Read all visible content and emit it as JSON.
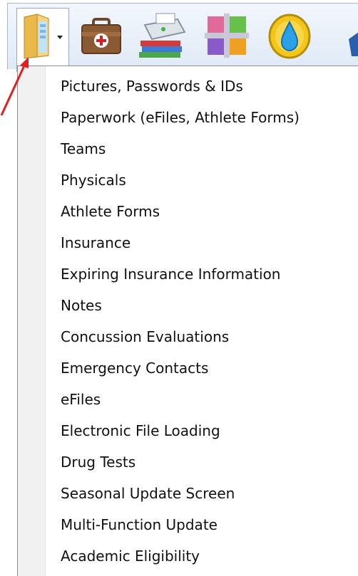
{
  "toolbar": {
    "buttons": [
      {
        "icon": "folder-icon",
        "has_dropdown": true
      },
      {
        "icon": "medical-briefcase-icon"
      },
      {
        "icon": "printer-books-icon"
      },
      {
        "icon": "colorful-grid-icon"
      },
      {
        "icon": "water-drop-coin-icon"
      }
    ]
  },
  "menu": {
    "items": [
      {
        "label": "Pictures, Passwords & IDs"
      },
      {
        "label": "Paperwork (eFiles, Athlete Forms)"
      },
      {
        "label": "Teams"
      },
      {
        "label": "Physicals"
      },
      {
        "label": "Athlete Forms"
      },
      {
        "label": "Insurance"
      },
      {
        "label": "Expiring Insurance Information"
      },
      {
        "label": "Notes"
      },
      {
        "label": "Concussion Evaluations"
      },
      {
        "label": "Emergency Contacts"
      },
      {
        "label": "eFiles"
      },
      {
        "label": "Electronic File Loading"
      },
      {
        "label": "Drug Tests"
      },
      {
        "label": "Seasonal Update Screen"
      },
      {
        "label": "Multi-Function Update"
      },
      {
        "label": "Academic Eligibility"
      }
    ]
  },
  "colors": {
    "annotation_arrow": "#e02020",
    "menu_gutter": "#f1f1f1",
    "toolbar_bg": "#e6eef9"
  }
}
